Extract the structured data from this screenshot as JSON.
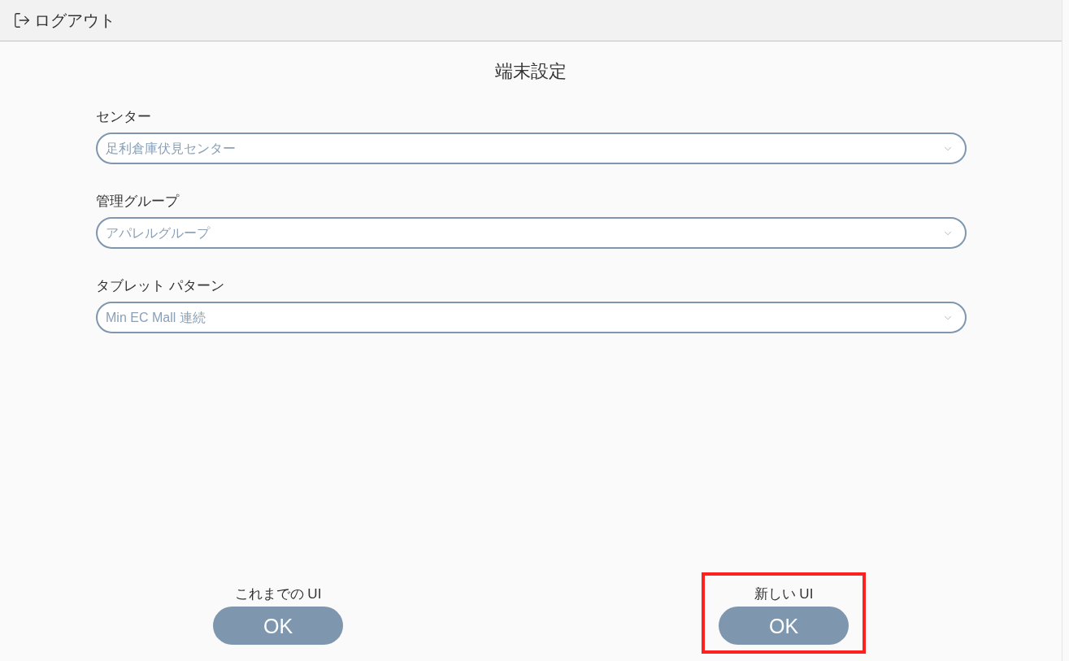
{
  "header": {
    "logout_label": "ログアウト"
  },
  "title": "端末設定",
  "fields": [
    {
      "label": "センター",
      "value": "足利倉庫伏見センター"
    },
    {
      "label": "管理グループ",
      "value": "アパレルグループ"
    },
    {
      "label": "タブレット パターン",
      "value": "Min EC Mall 連続"
    }
  ],
  "options": [
    {
      "label": "これまでの UI",
      "button": "OK",
      "highlighted": false
    },
    {
      "label": "新しい UI",
      "button": "OK",
      "highlighted": true
    }
  ]
}
